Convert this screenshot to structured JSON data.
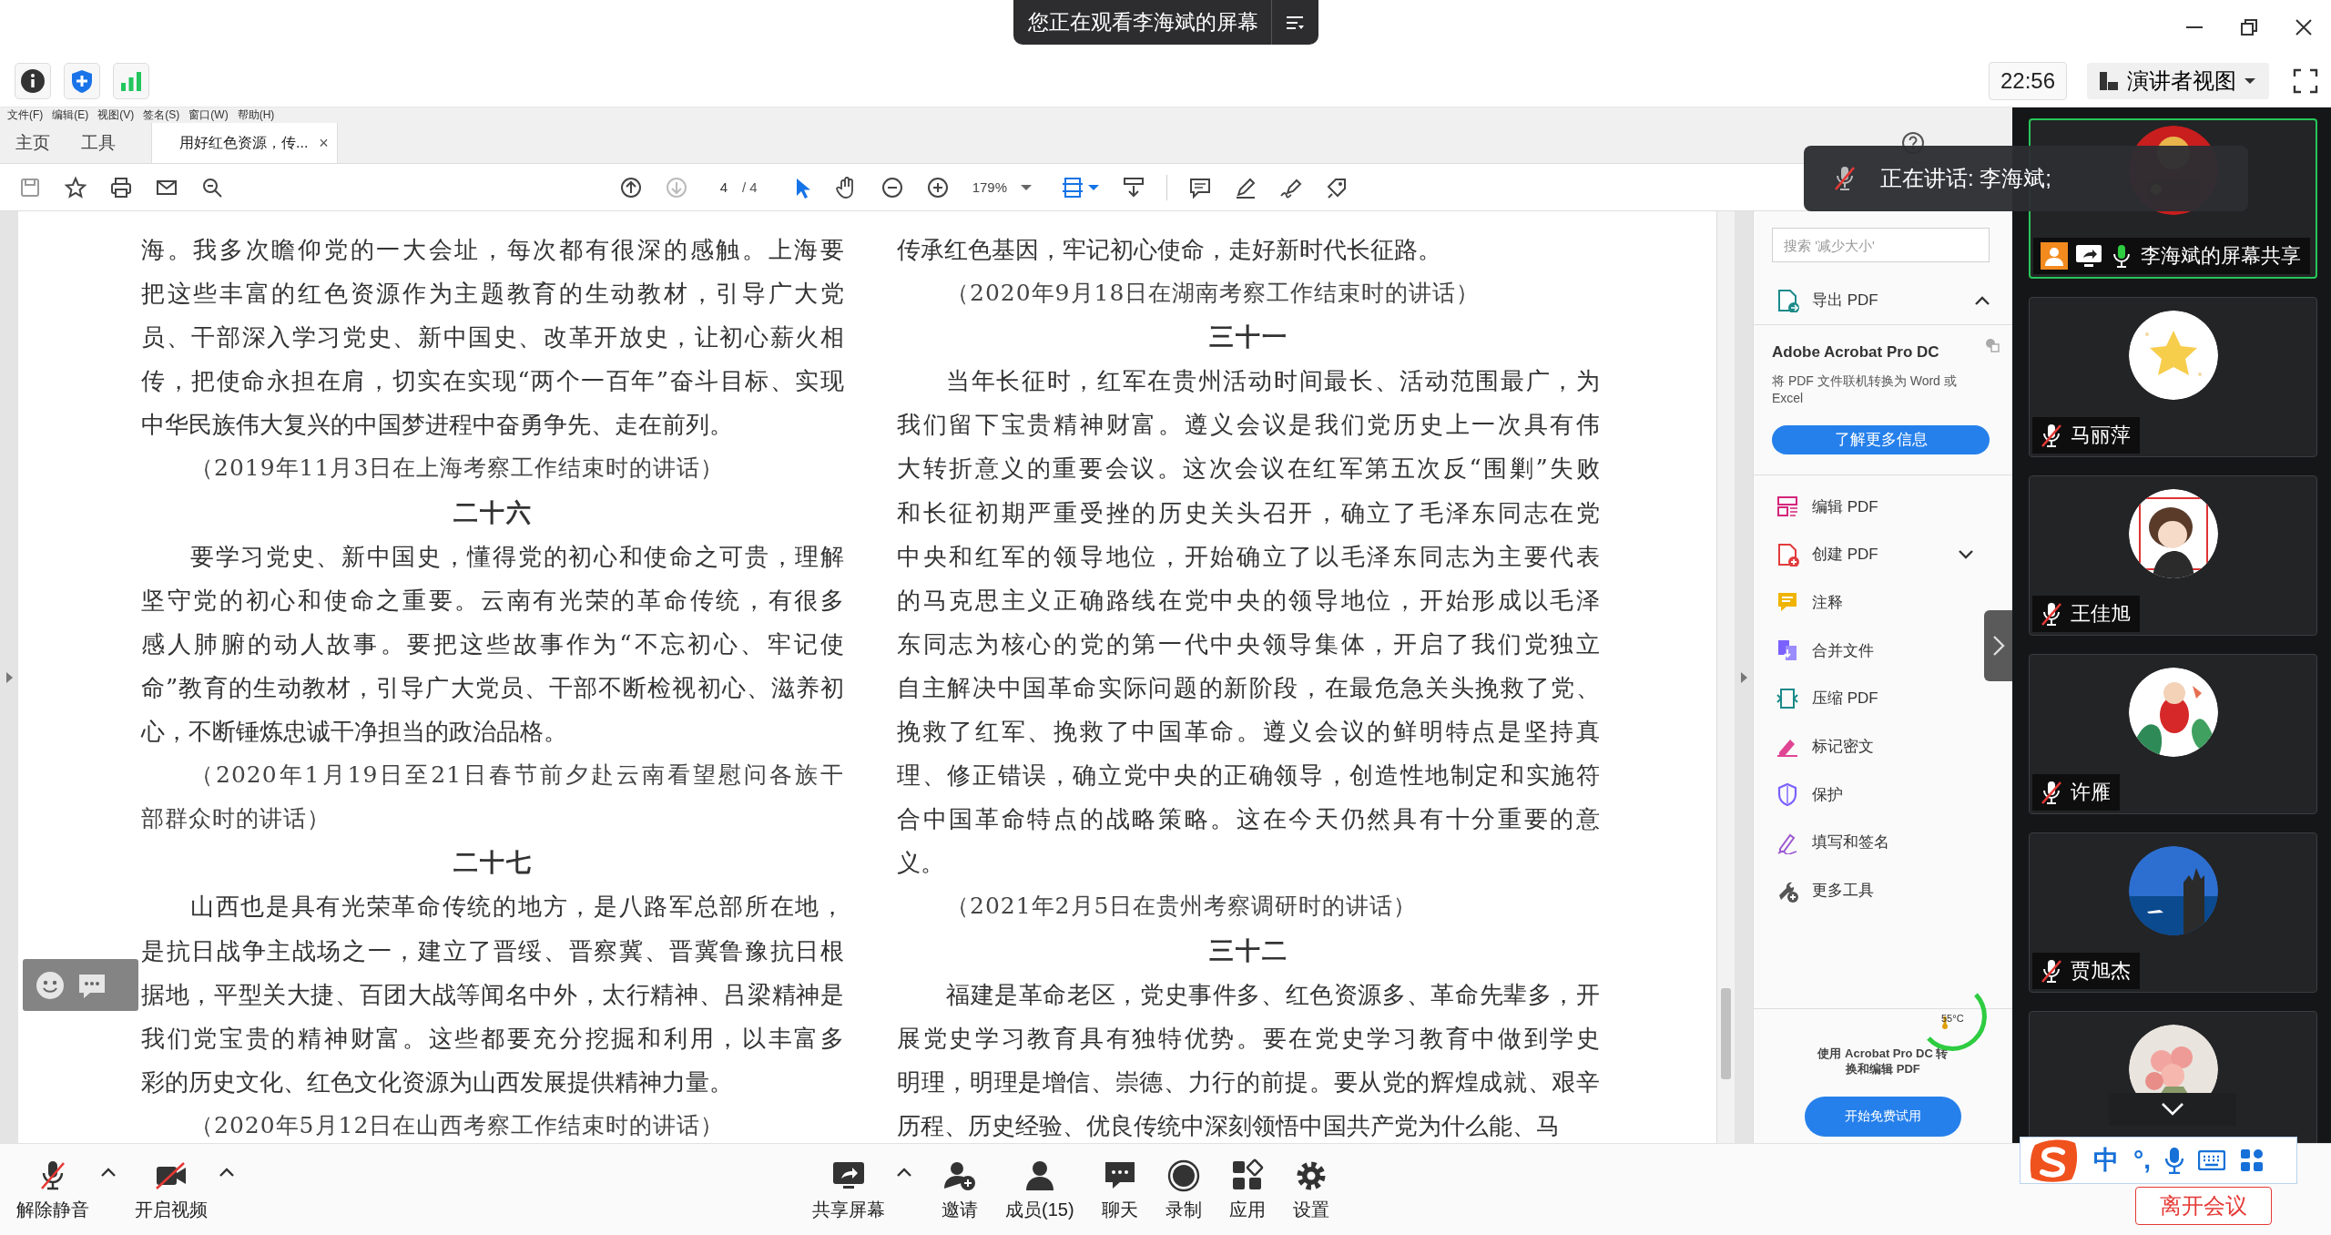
{
  "share_banner": {
    "title": "您正在观看李海斌的屏幕"
  },
  "meeting_header": {
    "time": "22:56",
    "view_menu": "演讲者视图"
  },
  "acrobat": {
    "menu": [
      "文件(F)",
      "编辑(E)",
      "视图(V)",
      "签名(S)",
      "窗口(W)",
      "帮助(H)"
    ],
    "tabs": [
      {
        "label": "主页",
        "selected": false
      },
      {
        "label": "工具",
        "selected": false
      },
      {
        "label": "用好红色资源，传...",
        "selected": true,
        "close": "×"
      }
    ],
    "toolbar": {
      "page": "4",
      "page_total": "/ 4",
      "zoom": "179%"
    },
    "document": {
      "columns": [
        [
          {
            "kind": "continuation",
            "lines": [
              "海。我多次瞻仰党的一大会址，每次都有很深的感触。上海要",
              "把这些丰富的红色资源作为主题教育的生动教材，引导广大党",
              "员、干部深入学习党史、新中国史、改革开放史，让初心薪火相",
              "传，把使命永担在肩，切实在实现“两个一百年”奋斗目标、实现",
              "中华民族伟大复兴的中国梦进程中奋勇争先、走在前列。"
            ]
          },
          {
            "kind": "citation",
            "lines": [
              "（2019年11月3日在上海考察工作结束时的讲话）"
            ]
          },
          {
            "kind": "heading",
            "lines": [
              "二十六"
            ]
          },
          {
            "kind": "paragraph",
            "lines": [
              "要学习党史、新中国史，懂得党的初心和使命之可贵，理解",
              "坚守党的初心和使命之重要。云南有光荣的革命传统，有很多",
              "感人肺腑的动人故事。要把这些故事作为“不忘初心、牢记使",
              "命”教育的生动教材，引导广大党员、干部不断检视初心、滋养初",
              "心，不断锤炼忠诚干净担当的政治品格。"
            ]
          },
          {
            "kind": "citation",
            "lines": [
              "（2020年1月19日至21日春节前夕赴云南看望慰问各族干",
              "部群众时的讲话）"
            ]
          },
          {
            "kind": "heading",
            "lines": [
              "二十七"
            ]
          },
          {
            "kind": "paragraph",
            "lines": [
              "山西也是具有光荣革命传统的地方，是八路军总部所在地，",
              "是抗日战争主战场之一，建立了晋绥、晋察冀、晋冀鲁豫抗日根",
              "据地，平型关大捷、百团大战等闻名中外，太行精神、吕梁精神是",
              "我们党宝贵的精神财富。这些都要充分挖掘和利用，以丰富多",
              "彩的历史文化、红色文化资源为山西发展提供精神力量。"
            ]
          },
          {
            "kind": "citation",
            "lines": [
              "（2020年5月12日在山西考察工作结束时的讲话）"
            ]
          }
        ],
        [
          {
            "kind": "continuation",
            "lines": [
              "传承红色基因，牢记初心使命，走好新时代长征路。"
            ]
          },
          {
            "kind": "citation",
            "lines": [
              "（2020年9月18日在湖南考察工作结束时的讲话）"
            ]
          },
          {
            "kind": "heading",
            "lines": [
              "三十一"
            ]
          },
          {
            "kind": "paragraph",
            "lines": [
              "当年长征时，红军在贵州活动时间最长、活动范围最广，为",
              "我们留下宝贵精神财富。遵义会议是我们党历史上一次具有伟",
              "大转折意义的重要会议。这次会议在红军第五次反“围剿”失败",
              "和长征初期严重受挫的历史关头召开，确立了毛泽东同志在党",
              "中央和红军的领导地位，开始确立了以毛泽东同志为主要代表",
              "的马克思主义正确路线在党中央的领导地位，开始形成以毛泽",
              "东同志为核心的党的第一代中央领导集体，开启了我们党独立",
              "自主解决中国革命实际问题的新阶段，在最危急关头挽救了党、",
              "挽救了红军、挽救了中国革命。遵义会议的鲜明特点是坚持真",
              "理、修正错误，确立党中央的正确领导，创造性地制定和实施符",
              "合中国革命特点的战略策略。这在今天仍然具有十分重要的意",
              "义。"
            ]
          },
          {
            "kind": "citation",
            "lines": [
              "（2021年2月5日在贵州考察调研时的讲话）"
            ]
          },
          {
            "kind": "heading",
            "lines": [
              "三十二"
            ]
          },
          {
            "kind": "paragraph",
            "lines": [
              "福建是革命老区，党史事件多、红色资源多、革命先辈多，开",
              "展党史学习教育具有独特优势。要在党史学习教育中做到学史",
              "明理，明理是增信、崇德、力行的前提。要从党的辉煌成就、艰辛",
              "历程、历史经验、优良传统中深刻领悟中国共产党为什么能、马"
            ]
          }
        ]
      ]
    },
    "tools_panel": {
      "search": {
        "placeholder": "搜索 '减少大小'"
      },
      "export": {
        "label": "导出 PDF",
        "expanded": true
      },
      "promo": {
        "title": "Adobe Acrobat Pro DC",
        "text": "将 PDF 文件联机转换为 Word 或 Excel",
        "button": "了解更多信息"
      },
      "tools": [
        {
          "kind": "edit",
          "label": "编辑 PDF",
          "has_menu": false
        },
        {
          "kind": "create",
          "label": "创建 PDF",
          "has_menu": true
        },
        {
          "kind": "comment",
          "label": "注释",
          "has_menu": false
        },
        {
          "kind": "combine",
          "label": "合并文件",
          "has_menu": false
        },
        {
          "kind": "compress",
          "label": "压缩 PDF",
          "has_menu": false
        },
        {
          "kind": "redact",
          "label": "标记密文",
          "has_menu": false
        },
        {
          "kind": "protect",
          "label": "保护",
          "has_menu": false
        },
        {
          "kind": "sign",
          "label": "填写和签名",
          "has_menu": false
        },
        {
          "kind": "more",
          "label": "更多工具",
          "has_menu": false
        }
      ],
      "trial": {
        "text": "使用 Acrobat Pro DC 转换和编辑 PDF",
        "button": "开始免费试用"
      }
    }
  },
  "temperature_widget": {
    "reading": "55°C"
  },
  "speaking_toast": {
    "text": "正在讲话: 李海斌;"
  },
  "participants": [
    {
      "kind": "share",
      "name": "李海斌的屏幕共享",
      "muted": false,
      "speaking": true
    },
    {
      "kind": "person",
      "name": "马丽萍",
      "muted": true,
      "speaking": false
    },
    {
      "kind": "person",
      "name": "王佳旭",
      "muted": true,
      "speaking": false
    },
    {
      "kind": "person",
      "name": "许雁",
      "muted": true,
      "speaking": false
    },
    {
      "kind": "person",
      "name": "贾旭杰",
      "muted": true,
      "speaking": false
    },
    {
      "kind": "person",
      "speaking": false
    }
  ],
  "meeting_toolbar": {
    "items": [
      {
        "kind": "mic",
        "label": "解除静音"
      },
      {
        "kind": "options"
      },
      {
        "kind": "video",
        "label": "开启视频"
      },
      {
        "kind": "options"
      },
      {
        "kind": "share",
        "label": "共享屏幕"
      },
      {
        "kind": "options"
      },
      {
        "kind": "invite",
        "label": "邀请"
      },
      {
        "kind": "members",
        "label": "成员(15)"
      },
      {
        "kind": "chat",
        "label": "聊天"
      },
      {
        "kind": "record",
        "label": "录制"
      },
      {
        "kind": "apps",
        "label": "应用"
      },
      {
        "kind": "settings",
        "label": "设置"
      }
    ],
    "leave": "离开会议"
  },
  "ime": {
    "mode": "中",
    "punctuation": "°,"
  }
}
